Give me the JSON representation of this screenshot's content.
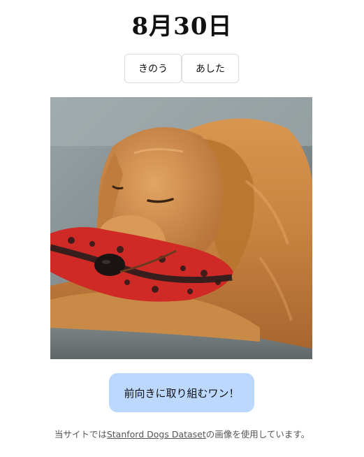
{
  "header": {
    "date": "8月30日"
  },
  "nav": {
    "prev_label": "きのう",
    "next_label": "あした"
  },
  "photo": {
    "subject": "golden retriever resting head on red toy"
  },
  "message": {
    "text": "前向きに取り組むワン！"
  },
  "footer": {
    "prefix": "当サイトでは",
    "link_text": "Stanford Dogs Dataset",
    "suffix": "の画像を使用しています。"
  },
  "colors": {
    "message_bg": "#bcd8ff",
    "button_border": "#dcdcdc",
    "credit_text": "#555555"
  }
}
